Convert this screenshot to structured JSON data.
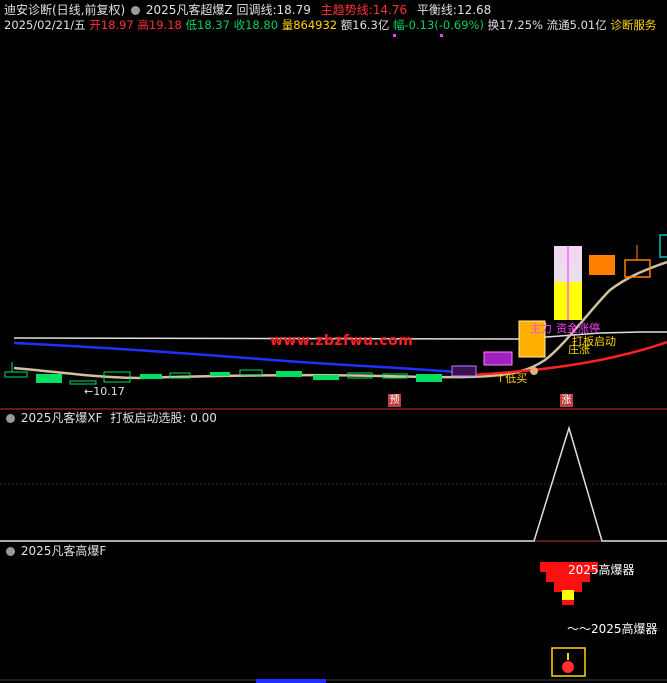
{
  "header": {
    "indicator_name": "迪安诊断(日线,前复权)",
    "formula_name": "2025凡客超爆Z",
    "pullback_label": "回调线:",
    "pullback_value": "18.79",
    "trend_label": "主趋势线:",
    "trend_value": "14.76",
    "balance_label": "平衡线:",
    "balance_value": "12.68"
  },
  "quote": {
    "date": "2025/02/21/五",
    "open_label": "开",
    "open": "18.97",
    "high_label": "高",
    "high": "19.18",
    "low_label": "低",
    "low": "18.37",
    "close_label": "收",
    "close": "18.80",
    "volume_label": "量",
    "volume": "864932",
    "amount_label": "额",
    "amount": "16.3亿",
    "change_label": "幅",
    "change": "-0.13(-0.69%)",
    "turnover_label": "换",
    "turnover": "17.25%",
    "float_label": "流通",
    "float": "5.01亿",
    "service_link": "诊断服务"
  },
  "main_chart": {
    "watermark": "www.zbzfwu.com",
    "low_price_marker": "←10.17",
    "signals": {
      "zhuli": "主力",
      "zhangban": "资金涨停",
      "daban": "打板启动",
      "zhuangzhang": "庄涨",
      "dimai": "↑低买"
    },
    "bottom_labels": {
      "yu": "预",
      "zhang": "涨"
    },
    "colors": {
      "bullish": "#ff3030",
      "bearish": "#00e060",
      "pullback_line": "#d0c0a0",
      "trend_line": "#ff2020",
      "balance_line": "#e0e0e0",
      "blue_line": "#2030ff"
    }
  },
  "panel2": {
    "name": "2025凡客爆XF",
    "label": "打板启动选股:",
    "value": "0.00"
  },
  "panel3": {
    "name": "2025凡客高爆F",
    "signal1": "2025高爆器",
    "signal2": "～～2025高爆器"
  }
}
